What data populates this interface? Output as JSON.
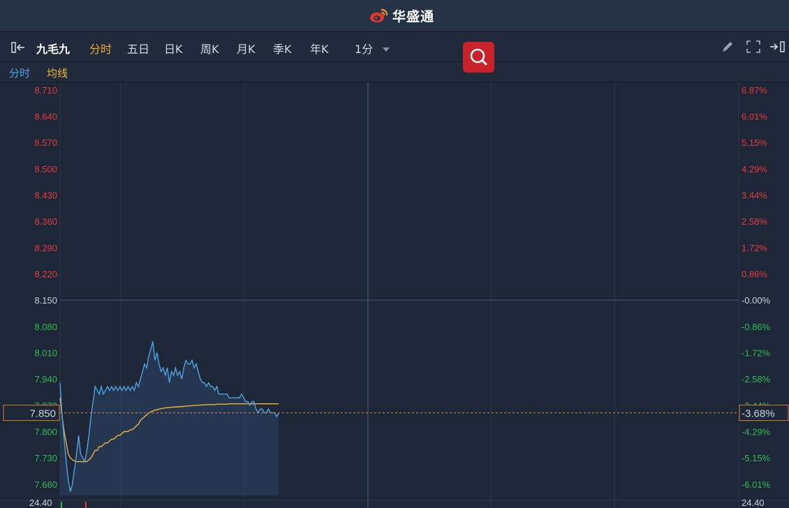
{
  "app": {
    "brand": "华盛通"
  },
  "toolbar": {
    "stock_name": "九毛九",
    "tabs": [
      "分时",
      "五日",
      "日K",
      "周K",
      "月K",
      "季K",
      "年K"
    ],
    "active_tab": "分时",
    "interval": "1分",
    "icons": [
      "collapse-left-icon",
      "search-icon",
      "pencil-icon",
      "fullscreen-icon",
      "collapse-right-icon"
    ]
  },
  "legend": {
    "price_label": "分时",
    "avg_label": "均线"
  },
  "colors": {
    "up": "#e23b3b",
    "down": "#2dbb55",
    "neutral": "#c9d1dc",
    "price_line": "#4fa3e0",
    "avg_line": "#f2b33b",
    "accent": "#f2a93b"
  },
  "chart_data": {
    "type": "line",
    "prev_close": 8.15,
    "ylim": [
      7.63,
      8.73
    ],
    "price_ticks": [
      "8.710",
      "8.640",
      "8.570",
      "8.500",
      "8.430",
      "8.360",
      "8.290",
      "8.220",
      "8.150",
      "8.080",
      "8.010",
      "7.940",
      "7.870",
      "7.800",
      "7.730",
      "7.660"
    ],
    "percent_ticks": [
      "6.87%",
      "6.01%",
      "5.15%",
      "4.29%",
      "3.44%",
      "2.58%",
      "1.72%",
      "0.86%",
      "-0.00%",
      "-0.86%",
      "-1.72%",
      "-2.58%",
      "-3.44%",
      "-4.29%",
      "-5.15%",
      "-6.01%"
    ],
    "current_price": "7.850",
    "current_percent": "-3.68%",
    "volume_max_left": "24.40",
    "volume_max_right": "24.40",
    "session_minutes": 330,
    "series": [
      {
        "values": [
          7.93,
          7.84,
          7.78,
          7.72,
          7.67,
          7.64,
          7.66,
          7.7,
          7.74,
          7.79,
          7.74,
          7.73,
          7.72,
          7.75,
          7.79,
          7.84,
          7.88,
          7.92,
          7.91,
          7.9,
          7.92,
          7.9,
          7.91,
          7.92,
          7.91,
          7.92,
          7.91,
          7.92,
          7.91,
          7.92,
          7.91,
          7.92,
          7.91,
          7.92,
          7.91,
          7.92,
          7.91,
          7.93,
          7.92,
          7.94,
          7.96,
          7.98,
          7.97,
          8.0,
          8.02,
          8.04,
          7.99,
          8.01,
          7.98,
          7.96,
          7.97,
          7.95,
          7.97,
          7.93,
          7.96,
          7.95,
          7.97,
          7.95,
          7.96,
          7.94,
          7.97,
          7.99,
          7.98,
          7.98,
          7.99,
          7.97,
          7.98,
          7.96,
          7.94,
          7.93,
          7.93,
          7.92,
          7.93,
          7.92,
          7.92,
          7.91,
          7.92,
          7.9,
          7.9,
          7.9,
          7.9,
          7.9,
          7.89,
          7.89,
          7.89,
          7.89,
          7.89,
          7.89,
          7.9,
          7.89,
          7.88,
          7.88,
          7.87,
          7.88,
          7.88,
          7.86,
          7.85,
          7.86,
          7.86,
          7.85,
          7.85,
          7.86,
          7.85,
          7.85,
          7.85,
          7.84,
          7.85
        ]
      },
      {
        "values": [
          7.89,
          7.84,
          7.8,
          7.77,
          7.74,
          7.73,
          7.725,
          7.722,
          7.72,
          7.72,
          7.72,
          7.72,
          7.72,
          7.72,
          7.725,
          7.73,
          7.74,
          7.75,
          7.75,
          7.76,
          7.76,
          7.765,
          7.77,
          7.77,
          7.775,
          7.78,
          7.78,
          7.785,
          7.79,
          7.79,
          7.795,
          7.8,
          7.8,
          7.8,
          7.805,
          7.805,
          7.81,
          7.815,
          7.82,
          7.83,
          7.835,
          7.84,
          7.845,
          7.85,
          7.852,
          7.855,
          7.857,
          7.858,
          7.86,
          7.861,
          7.862,
          7.863,
          7.864,
          7.864,
          7.865,
          7.865,
          7.866,
          7.866,
          7.866,
          7.867,
          7.867,
          7.868,
          7.868,
          7.869,
          7.869,
          7.87,
          7.87,
          7.87,
          7.871,
          7.871,
          7.871,
          7.872,
          7.872,
          7.872,
          7.872,
          7.872,
          7.873,
          7.873,
          7.873,
          7.873,
          7.873,
          7.873,
          7.874,
          7.874,
          7.874,
          7.874,
          7.874,
          7.874,
          7.874,
          7.874,
          7.874,
          7.874,
          7.874,
          7.874,
          7.874,
          7.874,
          7.874,
          7.874,
          7.874,
          7.874,
          7.874,
          7.874,
          7.874,
          7.874,
          7.874,
          7.874,
          7.874
        ]
      }
    ]
  }
}
